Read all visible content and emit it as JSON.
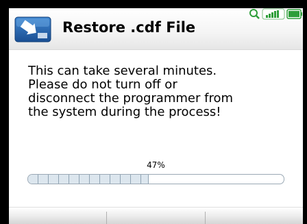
{
  "dialog": {
    "title": "Restore .cdf File",
    "message": "This can take several minutes.\nPlease do not turn off or\ndisconnect the programmer from\nthe system during the process!"
  },
  "progress": {
    "label": "47%",
    "value": 0.47
  },
  "icons": {
    "title_icon": "restore-arrow-icon",
    "status": [
      "search-icon",
      "signal-strength-icon",
      "battery-icon"
    ]
  },
  "colors": {
    "title_icon_blue": "#1f5ea8",
    "progress_fill": "#dce6ee",
    "progress_border": "#9aa8b4",
    "status_green": "#2e9e3a"
  },
  "softkeys": [
    "",
    "",
    ""
  ]
}
